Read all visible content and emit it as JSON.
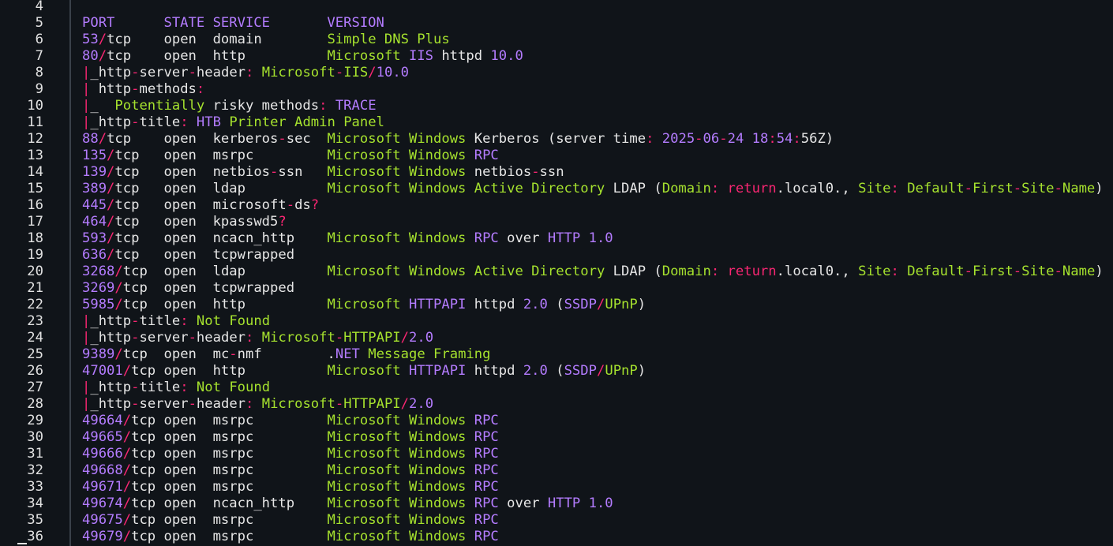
{
  "colors": {
    "background": "#101419",
    "number": "#b47cff",
    "string": "#a6e22e",
    "operator": "#f92672",
    "text": "#e6e6e6",
    "gutter_rule": "#3a4149"
  },
  "lines": [
    {
      "n": "4",
      "tokens": []
    },
    {
      "n": "5",
      "tokens": [
        [
          "n",
          "PORT      STATE SERVICE       VERSION"
        ]
      ]
    },
    {
      "n": "6",
      "tokens": [
        [
          "n",
          "53"
        ],
        [
          "p",
          "/"
        ],
        [
          "w",
          "tcp    open  domain        "
        ],
        [
          "g",
          "Simple DNS Plus"
        ]
      ]
    },
    {
      "n": "7",
      "tokens": [
        [
          "n",
          "80"
        ],
        [
          "p",
          "/"
        ],
        [
          "w",
          "tcp    open  http          "
        ],
        [
          "g",
          "Microsoft "
        ],
        [
          "n",
          "IIS"
        ],
        [
          "w",
          " httpd "
        ],
        [
          "n",
          "10.0"
        ]
      ]
    },
    {
      "n": "8",
      "tokens": [
        [
          "p",
          "|"
        ],
        [
          "w",
          "_http"
        ],
        [
          "p",
          "-"
        ],
        [
          "w",
          "server"
        ],
        [
          "p",
          "-"
        ],
        [
          "w",
          "header"
        ],
        [
          "p",
          ":"
        ],
        [
          "g",
          " Microsoft"
        ],
        [
          "p",
          "-"
        ],
        [
          "g",
          "IIS"
        ],
        [
          "p",
          "/"
        ],
        [
          "n",
          "10.0"
        ]
      ]
    },
    {
      "n": "9",
      "tokens": [
        [
          "p",
          "|"
        ],
        [
          "w",
          " http"
        ],
        [
          "p",
          "-"
        ],
        [
          "w",
          "methods"
        ],
        [
          "p",
          ":"
        ]
      ]
    },
    {
      "n": "10",
      "tokens": [
        [
          "p",
          "|"
        ],
        [
          "w",
          "_  "
        ],
        [
          "g",
          "Potentially"
        ],
        [
          "w",
          " risky methods"
        ],
        [
          "p",
          ":"
        ],
        [
          "n",
          " TRACE"
        ]
      ]
    },
    {
      "n": "11",
      "tokens": [
        [
          "p",
          "|"
        ],
        [
          "w",
          "_http"
        ],
        [
          "p",
          "-"
        ],
        [
          "w",
          "title"
        ],
        [
          "p",
          ":"
        ],
        [
          "n",
          " HTB"
        ],
        [
          "g",
          " Printer Admin Panel"
        ]
      ]
    },
    {
      "n": "12",
      "tokens": [
        [
          "n",
          "88"
        ],
        [
          "p",
          "/"
        ],
        [
          "w",
          "tcp    open  kerberos"
        ],
        [
          "p",
          "-"
        ],
        [
          "w",
          "sec  "
        ],
        [
          "g",
          "Microsoft Windows"
        ],
        [
          "w",
          " Kerberos (server time"
        ],
        [
          "p",
          ":"
        ],
        [
          "n",
          " 2025"
        ],
        [
          "p",
          "-"
        ],
        [
          "n",
          "06"
        ],
        [
          "p",
          "-"
        ],
        [
          "n",
          "24 18"
        ],
        [
          "p",
          ":"
        ],
        [
          "n",
          "54"
        ],
        [
          "p",
          ":"
        ],
        [
          "w",
          "56Z)"
        ]
      ]
    },
    {
      "n": "13",
      "tokens": [
        [
          "n",
          "135"
        ],
        [
          "p",
          "/"
        ],
        [
          "w",
          "tcp   open  msrpc         "
        ],
        [
          "g",
          "Microsoft Windows "
        ],
        [
          "n",
          "RPC"
        ]
      ]
    },
    {
      "n": "14",
      "tokens": [
        [
          "n",
          "139"
        ],
        [
          "p",
          "/"
        ],
        [
          "w",
          "tcp   open  netbios"
        ],
        [
          "p",
          "-"
        ],
        [
          "w",
          "ssn   "
        ],
        [
          "g",
          "Microsoft Windows"
        ],
        [
          "w",
          " netbios"
        ],
        [
          "p",
          "-"
        ],
        [
          "w",
          "ssn"
        ]
      ]
    },
    {
      "n": "15",
      "tokens": [
        [
          "n",
          "389"
        ],
        [
          "p",
          "/"
        ],
        [
          "w",
          "tcp   open  ldap          "
        ],
        [
          "g",
          "Microsoft Windows Active Directory"
        ],
        [
          "w",
          " LDAP ("
        ],
        [
          "g",
          "Domain"
        ],
        [
          "p",
          ":"
        ],
        [
          "p",
          " return"
        ],
        [
          "w",
          ".local0., "
        ],
        [
          "g",
          "Site"
        ],
        [
          "p",
          ":"
        ],
        [
          "g",
          " Default"
        ],
        [
          "p",
          "-"
        ],
        [
          "g",
          "First"
        ],
        [
          "p",
          "-"
        ],
        [
          "g",
          "Site"
        ],
        [
          "p",
          "-"
        ],
        [
          "g",
          "Name"
        ],
        [
          "w",
          ")"
        ]
      ]
    },
    {
      "n": "16",
      "tokens": [
        [
          "n",
          "445"
        ],
        [
          "p",
          "/"
        ],
        [
          "w",
          "tcp   open  microsoft"
        ],
        [
          "p",
          "-"
        ],
        [
          "w",
          "ds"
        ],
        [
          "p",
          "?"
        ]
      ]
    },
    {
      "n": "17",
      "tokens": [
        [
          "n",
          "464"
        ],
        [
          "p",
          "/"
        ],
        [
          "w",
          "tcp   open  kpasswd5"
        ],
        [
          "p",
          "?"
        ]
      ]
    },
    {
      "n": "18",
      "tokens": [
        [
          "n",
          "593"
        ],
        [
          "p",
          "/"
        ],
        [
          "w",
          "tcp   open  ncacn_http    "
        ],
        [
          "g",
          "Microsoft Windows "
        ],
        [
          "n",
          "RPC"
        ],
        [
          "w",
          " over "
        ],
        [
          "n",
          "HTTP 1.0"
        ]
      ]
    },
    {
      "n": "19",
      "tokens": [
        [
          "n",
          "636"
        ],
        [
          "p",
          "/"
        ],
        [
          "w",
          "tcp   open  tcpwrapped"
        ]
      ]
    },
    {
      "n": "20",
      "tokens": [
        [
          "n",
          "3268"
        ],
        [
          "p",
          "/"
        ],
        [
          "w",
          "tcp  open  ldap          "
        ],
        [
          "g",
          "Microsoft Windows Active Directory"
        ],
        [
          "w",
          " LDAP ("
        ],
        [
          "g",
          "Domain"
        ],
        [
          "p",
          ":"
        ],
        [
          "p",
          " return"
        ],
        [
          "w",
          ".local0., "
        ],
        [
          "g",
          "Site"
        ],
        [
          "p",
          ":"
        ],
        [
          "g",
          " Default"
        ],
        [
          "p",
          "-"
        ],
        [
          "g",
          "First"
        ],
        [
          "p",
          "-"
        ],
        [
          "g",
          "Site"
        ],
        [
          "p",
          "-"
        ],
        [
          "g",
          "Name"
        ],
        [
          "w",
          ")"
        ]
      ]
    },
    {
      "n": "21",
      "tokens": [
        [
          "n",
          "3269"
        ],
        [
          "p",
          "/"
        ],
        [
          "w",
          "tcp  open  tcpwrapped"
        ]
      ]
    },
    {
      "n": "22",
      "tokens": [
        [
          "n",
          "5985"
        ],
        [
          "p",
          "/"
        ],
        [
          "w",
          "tcp  open  http          "
        ],
        [
          "g",
          "Microsoft "
        ],
        [
          "n",
          "HTTPAPI"
        ],
        [
          "w",
          " httpd "
        ],
        [
          "n",
          "2.0"
        ],
        [
          "w",
          " ("
        ],
        [
          "n",
          "SSDP"
        ],
        [
          "p",
          "/"
        ],
        [
          "g",
          "UPnP"
        ],
        [
          "w",
          ")"
        ]
      ]
    },
    {
      "n": "23",
      "tokens": [
        [
          "p",
          "|"
        ],
        [
          "w",
          "_http"
        ],
        [
          "p",
          "-"
        ],
        [
          "w",
          "title"
        ],
        [
          "p",
          ":"
        ],
        [
          "g",
          " Not Found"
        ]
      ]
    },
    {
      "n": "24",
      "tokens": [
        [
          "p",
          "|"
        ],
        [
          "w",
          "_http"
        ],
        [
          "p",
          "-"
        ],
        [
          "w",
          "server"
        ],
        [
          "p",
          "-"
        ],
        [
          "w",
          "header"
        ],
        [
          "p",
          ":"
        ],
        [
          "g",
          " Microsoft"
        ],
        [
          "p",
          "-"
        ],
        [
          "g",
          "HTTPAPI"
        ],
        [
          "p",
          "/"
        ],
        [
          "n",
          "2.0"
        ]
      ]
    },
    {
      "n": "25",
      "tokens": [
        [
          "n",
          "9389"
        ],
        [
          "p",
          "/"
        ],
        [
          "w",
          "tcp  open  mc"
        ],
        [
          "p",
          "-"
        ],
        [
          "w",
          "nmf        ."
        ],
        [
          "n",
          "NET"
        ],
        [
          "g",
          " Message Framing"
        ]
      ]
    },
    {
      "n": "26",
      "tokens": [
        [
          "n",
          "47001"
        ],
        [
          "p",
          "/"
        ],
        [
          "w",
          "tcp open  http          "
        ],
        [
          "g",
          "Microsoft "
        ],
        [
          "n",
          "HTTPAPI"
        ],
        [
          "w",
          " httpd "
        ],
        [
          "n",
          "2.0"
        ],
        [
          "w",
          " ("
        ],
        [
          "n",
          "SSDP"
        ],
        [
          "p",
          "/"
        ],
        [
          "g",
          "UPnP"
        ],
        [
          "w",
          ")"
        ]
      ]
    },
    {
      "n": "27",
      "tokens": [
        [
          "p",
          "|"
        ],
        [
          "w",
          "_http"
        ],
        [
          "p",
          "-"
        ],
        [
          "w",
          "title"
        ],
        [
          "p",
          ":"
        ],
        [
          "g",
          " Not Found"
        ]
      ]
    },
    {
      "n": "28",
      "tokens": [
        [
          "p",
          "|"
        ],
        [
          "w",
          "_http"
        ],
        [
          "p",
          "-"
        ],
        [
          "w",
          "server"
        ],
        [
          "p",
          "-"
        ],
        [
          "w",
          "header"
        ],
        [
          "p",
          ":"
        ],
        [
          "g",
          " Microsoft"
        ],
        [
          "p",
          "-"
        ],
        [
          "g",
          "HTTPAPI"
        ],
        [
          "p",
          "/"
        ],
        [
          "n",
          "2.0"
        ]
      ]
    },
    {
      "n": "29",
      "tokens": [
        [
          "n",
          "49664"
        ],
        [
          "p",
          "/"
        ],
        [
          "w",
          "tcp open  msrpc         "
        ],
        [
          "g",
          "Microsoft Windows "
        ],
        [
          "n",
          "RPC"
        ]
      ]
    },
    {
      "n": "30",
      "tokens": [
        [
          "n",
          "49665"
        ],
        [
          "p",
          "/"
        ],
        [
          "w",
          "tcp open  msrpc         "
        ],
        [
          "g",
          "Microsoft Windows "
        ],
        [
          "n",
          "RPC"
        ]
      ]
    },
    {
      "n": "31",
      "tokens": [
        [
          "n",
          "49666"
        ],
        [
          "p",
          "/"
        ],
        [
          "w",
          "tcp open  msrpc         "
        ],
        [
          "g",
          "Microsoft Windows "
        ],
        [
          "n",
          "RPC"
        ]
      ]
    },
    {
      "n": "32",
      "tokens": [
        [
          "n",
          "49668"
        ],
        [
          "p",
          "/"
        ],
        [
          "w",
          "tcp open  msrpc         "
        ],
        [
          "g",
          "Microsoft Windows "
        ],
        [
          "n",
          "RPC"
        ]
      ]
    },
    {
      "n": "33",
      "tokens": [
        [
          "n",
          "49671"
        ],
        [
          "p",
          "/"
        ],
        [
          "w",
          "tcp open  msrpc         "
        ],
        [
          "g",
          "Microsoft Windows "
        ],
        [
          "n",
          "RPC"
        ]
      ]
    },
    {
      "n": "34",
      "tokens": [
        [
          "n",
          "49674"
        ],
        [
          "p",
          "/"
        ],
        [
          "w",
          "tcp open  ncacn_http    "
        ],
        [
          "g",
          "Microsoft Windows "
        ],
        [
          "n",
          "RPC"
        ],
        [
          "w",
          " over "
        ],
        [
          "n",
          "HTTP 1.0"
        ]
      ]
    },
    {
      "n": "35",
      "tokens": [
        [
          "n",
          "49675"
        ],
        [
          "p",
          "/"
        ],
        [
          "w",
          "tcp open  msrpc         "
        ],
        [
          "g",
          "Microsoft Windows "
        ],
        [
          "n",
          "RPC"
        ]
      ]
    },
    {
      "n": "36",
      "tokens": [
        [
          "n",
          "49679"
        ],
        [
          "p",
          "/"
        ],
        [
          "w",
          "tcp open  msrpc         "
        ],
        [
          "g",
          "Microsoft Windows "
        ],
        [
          "n",
          "RPC"
        ]
      ]
    }
  ]
}
